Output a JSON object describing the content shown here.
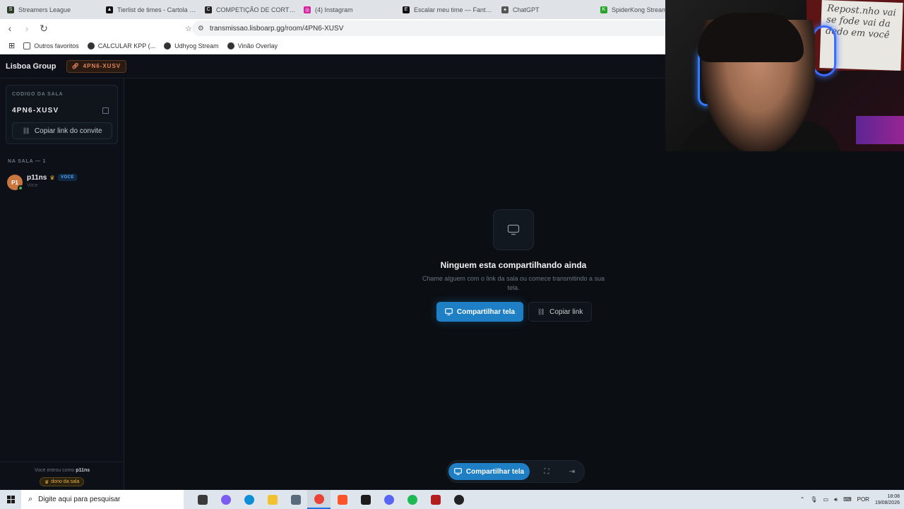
{
  "browser": {
    "tabs": [
      {
        "title": "Streamers League",
        "color": "#2f3b2a",
        "glyph": "S"
      },
      {
        "title": "Tierlist de times - Cartola da S",
        "color": "#111111",
        "glyph": "▲"
      },
      {
        "title": "COMPETIÇÃO DE CORTES DO",
        "color": "#222222",
        "glyph": "C"
      },
      {
        "title": "(4) Instagram",
        "color": "#d6249f",
        "glyph": "◎"
      },
      {
        "title": "Escalar meu time — Fantasy d",
        "color": "#111111",
        "glyph": "E"
      },
      {
        "title": "ChatGPT",
        "color": "#555555",
        "glyph": "✦"
      },
      {
        "title": "SpiderKong Stream - V",
        "color": "#29a329",
        "glyph": "K"
      }
    ],
    "url": "transmissao.lisboarp.gg/room/4PN6-XUSV",
    "bookmarks": [
      "Outros favoritos",
      "CALCULAR KPP (...",
      "Udhyog Stream",
      "Vinão Overlay"
    ]
  },
  "app": {
    "brand": "Lisboa Group",
    "room_code_pill": "4PN6-XUSV"
  },
  "sidebar": {
    "code_label": "CODIGO DA SALA",
    "code_value": "4PN6-XUSV",
    "invite_button": "Copiar link do convite",
    "section_label": "NA SALA — 1",
    "members": [
      {
        "initials": "P1",
        "name": "p11ns",
        "badge": "VOCE",
        "subtitle": "Voce"
      }
    ],
    "footer_text_prefix": "Voce entrou como",
    "footer_user": "p11ns",
    "owner_badge": "dono da sala"
  },
  "main": {
    "empty_title": "Ninguem esta compartilhando ainda",
    "empty_desc": "Chame alguem com o link da sala ou comece transmitindo a sua tela.",
    "share_button": "Compartilhar tela",
    "copy_button": "Copiar link",
    "bottom_share_button": "Compartilhar tela"
  },
  "webcam": {
    "whiteboard_text": "Repost.nho vai se fode vai da dedo em você"
  },
  "taskbar": {
    "search_placeholder": "Digite aqui para pesquisar",
    "apps": [
      {
        "name": "task-view",
        "color": "#3a3a3a"
      },
      {
        "name": "copilot",
        "color": "#7a5cf0"
      },
      {
        "name": "edge",
        "color": "#0c8fd6"
      },
      {
        "name": "explorer",
        "color": "#f2c12e"
      },
      {
        "name": "pin",
        "color": "#5a6b7c"
      },
      {
        "name": "chrome",
        "color": "#ea4335",
        "active": true
      },
      {
        "name": "brave",
        "color": "#fb542b"
      },
      {
        "name": "vivaldi",
        "color": "#1c1c1c"
      },
      {
        "name": "discord",
        "color": "#5865f2"
      },
      {
        "name": "spotify",
        "color": "#1db954"
      },
      {
        "name": "voicemeeter",
        "color": "#b31d1d"
      },
      {
        "name": "obs",
        "color": "#222222"
      }
    ],
    "language": "POR",
    "time": "18:08",
    "date": "19/08/2026"
  }
}
